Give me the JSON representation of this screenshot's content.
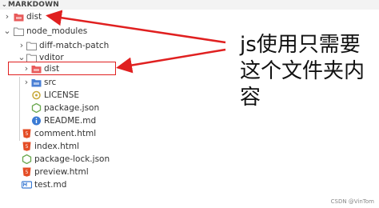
{
  "explorer": {
    "title": "MARKDOWN",
    "items": [
      {
        "label": "dist",
        "type": "folder-red",
        "arrow": "›"
      },
      {
        "label": "node_modules",
        "type": "folder-plain",
        "arrow": "⌄"
      },
      {
        "label": "diff-match-patch",
        "type": "folder-plain",
        "arrow": "›"
      },
      {
        "label": "vditor",
        "type": "folder-plain",
        "arrow": "⌄"
      },
      {
        "label": "dist",
        "type": "folder-red",
        "arrow": "›"
      },
      {
        "label": "src",
        "type": "folder-blue",
        "arrow": "›"
      },
      {
        "label": "LICENSE",
        "type": "license",
        "arrow": ""
      },
      {
        "label": "package.json",
        "type": "json",
        "arrow": ""
      },
      {
        "label": "README.md",
        "type": "info",
        "arrow": ""
      },
      {
        "label": "comment.html",
        "type": "html",
        "arrow": ""
      },
      {
        "label": "index.html",
        "type": "html",
        "arrow": ""
      },
      {
        "label": "package-lock.json",
        "type": "json",
        "arrow": ""
      },
      {
        "label": "preview.html",
        "type": "html",
        "arrow": ""
      },
      {
        "label": "test.md",
        "type": "md",
        "arrow": ""
      }
    ]
  },
  "annotation": {
    "lines": [
      "js使用只需要",
      "这个文件夹内",
      "容"
    ]
  },
  "watermark": "CSDN @VinTom",
  "colors": {
    "arrow_red": "#e02020",
    "folder_red": "#e85a5a",
    "folder_blue": "#4a7fd4",
    "html_orange": "#e44d26",
    "md_blue": "#3b7bd4"
  }
}
